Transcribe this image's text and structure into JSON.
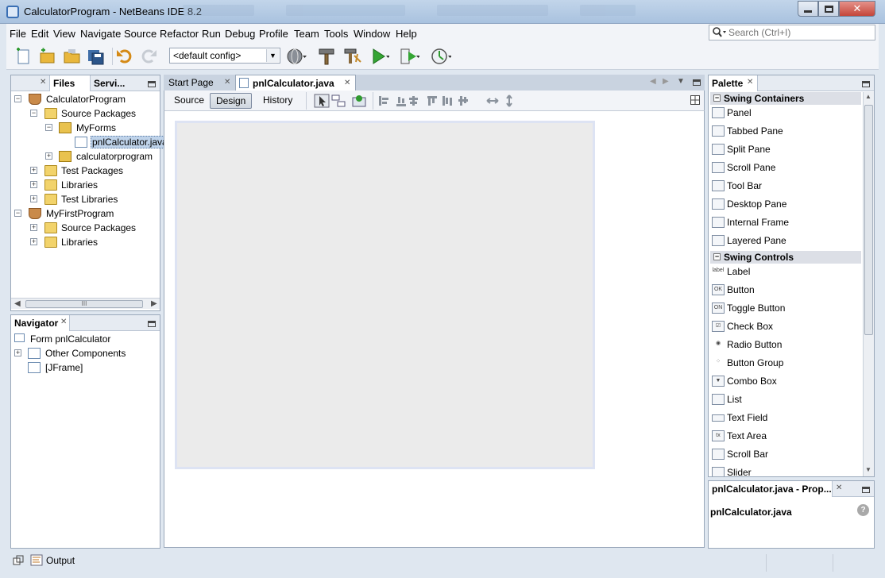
{
  "window": {
    "title": "CalculatorProgram - NetBeans IDE 8.2",
    "close_glyph": "✕"
  },
  "menu": [
    "File",
    "Edit",
    "View",
    "Navigate",
    "Source",
    "Refactor",
    "Run",
    "Debug",
    "Profile",
    "Team",
    "Tools",
    "Window",
    "Help"
  ],
  "search": {
    "placeholder": "Search (Ctrl+I)"
  },
  "toolbar": {
    "config_value": "<default config>",
    "icons": [
      "new-file-icon",
      "new-project-icon",
      "open-project-icon",
      "save-all-icon",
      "undo-icon",
      "redo-icon",
      "globe-icon",
      "build-icon",
      "clean-build-icon",
      "run-icon",
      "debug-icon",
      "profile-icon"
    ]
  },
  "projects_panel": {
    "tabs": [
      "Files",
      "Servi..."
    ],
    "tree": [
      {
        "label": "CalculatorProgram",
        "expander": "−"
      },
      {
        "label": "Source Packages",
        "expander": "−"
      },
      {
        "label": "MyForms",
        "expander": "−"
      },
      {
        "label": "pnlCalculator.java",
        "expander": ""
      },
      {
        "label": "calculatorprogram",
        "expander": "+"
      },
      {
        "label": "Test Packages",
        "expander": "+"
      },
      {
        "label": "Libraries",
        "expander": "+"
      },
      {
        "label": "Test Libraries",
        "expander": "+"
      },
      {
        "label": "MyFirstProgram",
        "expander": "−"
      },
      {
        "label": "Source Packages",
        "expander": "+"
      },
      {
        "label": "Libraries",
        "expander": "+"
      }
    ],
    "hscroll_grip": "III"
  },
  "navigator": {
    "title": "Navigator",
    "items": [
      "Form pnlCalculator",
      "Other Components",
      "[JFrame]"
    ]
  },
  "editor": {
    "tabs": [
      "Start Page",
      "pnlCalculator.java"
    ],
    "views": [
      "Source",
      "Design",
      "History"
    ]
  },
  "palette": {
    "title": "Palette",
    "categories": [
      {
        "name": "Swing Containers",
        "items": [
          "Panel",
          "Tabbed Pane",
          "Split Pane",
          "Scroll Pane",
          "Tool Bar",
          "Desktop Pane",
          "Internal Frame",
          "Layered Pane"
        ]
      },
      {
        "name": "Swing Controls",
        "items": [
          "Label",
          "Button",
          "Toggle Button",
          "Check Box",
          "Radio Button",
          "Button Group",
          "Combo Box",
          "List",
          "Text Field",
          "Text Area",
          "Scroll Bar",
          "Slider"
        ]
      }
    ],
    "item_icon_text": {
      "Label": "label",
      "Button": "OK",
      "Toggle Button": "ON",
      "Text Area": "tx"
    }
  },
  "properties": {
    "title": "pnlCalculator.java - Prop...",
    "file": "pnlCalculator.java"
  },
  "statusbar": {
    "output": "Output"
  },
  "glyphs": {
    "close": "✕",
    "collapse": "−",
    "expand": "+",
    "dropdown": "▼"
  }
}
